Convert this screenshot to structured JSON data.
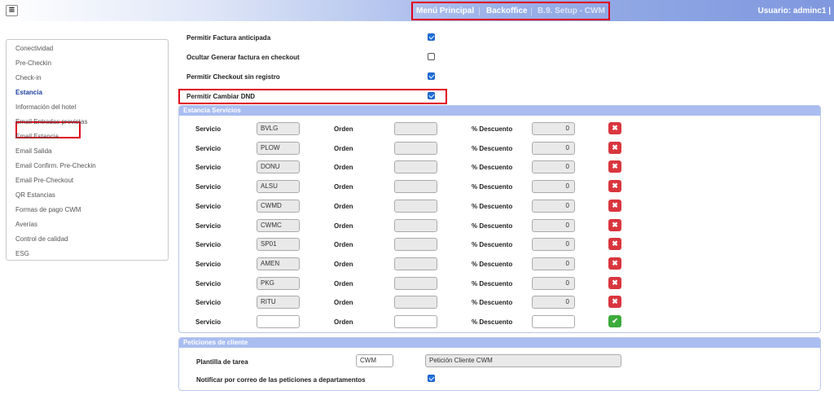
{
  "topbar": {
    "menu_icon": "hamburger-icon",
    "nav": [
      "Menú Principal",
      "Backoffice",
      "B.9. Setup - CWM"
    ],
    "user": "Usuario: adminc1 |"
  },
  "sidebar": {
    "items": [
      "Conectividad",
      "Pre-Checkin",
      "Check-in",
      "Estancia",
      "Información del hotel",
      "Email Entradas previstas",
      "Email Estancia",
      "Email Salida",
      "Email Confirm. Pre-Checkin",
      "Email Pre-Checkout",
      "QR Estancias",
      "Formas de pago CWM",
      "Averías",
      "Control de calidad",
      "ESG"
    ],
    "active": "Estancia"
  },
  "options": [
    {
      "label": "Permitir Factura anticipada",
      "checked": true
    },
    {
      "label": "Ocultar Generar factura en checkout",
      "checked": false
    },
    {
      "label": "Permitir Checkout sin registro",
      "checked": true
    },
    {
      "label": "Permitir Cambiar DND",
      "checked": true
    }
  ],
  "servicios": {
    "title": "Estancia Servicios",
    "col_servicio": "Servicio",
    "col_orden": "Orden",
    "col_descuento": "% Descuento",
    "rows": [
      {
        "servicio": "BVLG",
        "orden": "",
        "descuento": "0"
      },
      {
        "servicio": "PLOW",
        "orden": "",
        "descuento": "0"
      },
      {
        "servicio": "DONU",
        "orden": "",
        "descuento": "0"
      },
      {
        "servicio": "ALSU",
        "orden": "",
        "descuento": "0"
      },
      {
        "servicio": "CWMD",
        "orden": "",
        "descuento": "0"
      },
      {
        "servicio": "CWMC",
        "orden": "",
        "descuento": "0"
      },
      {
        "servicio": "SP01",
        "orden": "",
        "descuento": "0"
      },
      {
        "servicio": "AMEN",
        "orden": "",
        "descuento": "0"
      },
      {
        "servicio": "PKG",
        "orden": "",
        "descuento": "0"
      },
      {
        "servicio": "RITU",
        "orden": "",
        "descuento": "0"
      }
    ],
    "delete_glyph": "✖",
    "add_glyph": "✔"
  },
  "peticiones": {
    "title": "Peticiones de cliente",
    "plantilla_label": "Plantilla de tarea",
    "plantilla_code": "CWM",
    "plantilla_desc": "Petición Cliente CWM",
    "notificar_label": "Notificar por correo de las peticiones a departamentos",
    "notificar_checked": true
  },
  "colors": {
    "accent": "#1f6fde",
    "panel_header": "#a9bdf0",
    "delete": "#d9363e",
    "add": "#3cab3c",
    "highlight": "#e0001a"
  }
}
